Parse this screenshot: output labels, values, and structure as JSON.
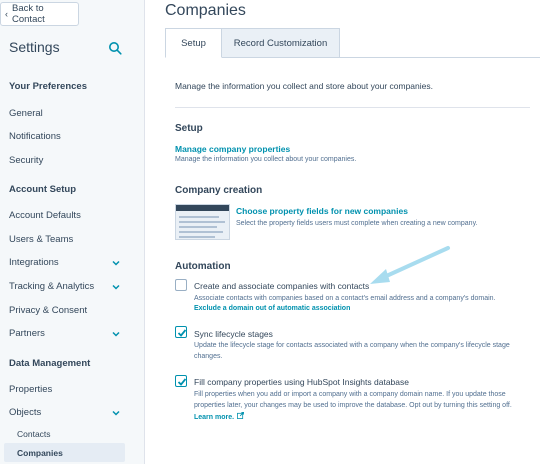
{
  "sidebar": {
    "back_label": "Back to Contact",
    "title": "Settings",
    "groups": {
      "preferences": "Your Preferences",
      "account_setup": "Account Setup",
      "data_management": "Data Management"
    },
    "items": {
      "general": "General",
      "notifications": "Notifications",
      "security": "Security",
      "account_defaults": "Account Defaults",
      "users_teams": "Users & Teams",
      "integrations": "Integrations",
      "tracking": "Tracking & Analytics",
      "privacy": "Privacy & Consent",
      "partners": "Partners",
      "properties": "Properties",
      "objects": "Objects",
      "contacts": "Contacts",
      "companies": "Companies"
    }
  },
  "main": {
    "title": "Companies",
    "tabs": {
      "setup": "Setup",
      "record": "Record Customization"
    },
    "intro": "Manage the information you collect and store about your companies.",
    "setup": {
      "title": "Setup",
      "link": "Manage company properties",
      "desc": "Manage the information you collect about your companies."
    },
    "creation": {
      "title": "Company creation",
      "link": "Choose property fields for new companies",
      "desc": "Select the property fields users must complete when creating a new company."
    },
    "automation": {
      "title": "Automation",
      "create": {
        "label": "Create and associate companies with contacts",
        "desc": "Associate contacts with companies based on a contact's email address and a company's domain.",
        "link": "Exclude a domain out of automatic association",
        "checked": false
      },
      "sync": {
        "label": "Sync lifecycle stages",
        "desc1": "Update the lifecycle stage for contacts associated with a company when the company's lifecycle stage",
        "desc2": "changes.",
        "checked": true
      },
      "fill": {
        "label": "Fill company properties using HubSpot Insights database",
        "desc1": "Fill properties when you add or import a company with a company domain name. If you update those",
        "desc2": "properties later, your changes may be used to improve the database. Opt out by turning this setting off.",
        "learn_more": "Learn more.",
        "checked": true
      }
    }
  },
  "colors": {
    "accent": "#0091ae",
    "text": "#33475b",
    "arrow": "#a8dcef"
  }
}
